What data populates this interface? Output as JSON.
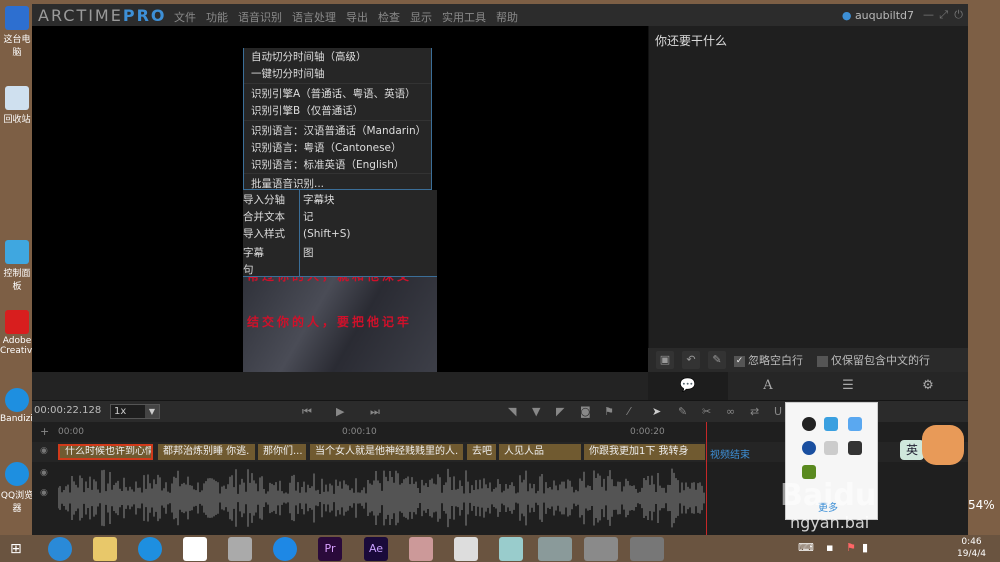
{
  "desktop": {
    "icons": [
      "这台电脑",
      "回收站",
      "控制面板",
      "Adobe Creative",
      "Bandizip",
      "QQ浏览器"
    ]
  },
  "app": {
    "logo_main": "ARCTIME",
    "logo_pro": "PRO",
    "menu": [
      "文件",
      "功能",
      "语音识别",
      "语言处理",
      "导出",
      "检查",
      "显示",
      "实用工具",
      "帮助"
    ],
    "user": "auqubiltd7"
  },
  "dropdown": {
    "items": [
      "自动切分时间轴（高级）",
      "一键切分时间轴",
      "识别引擎A（普通话、粤语、英语）",
      "识别引擎B（仅普通话）",
      "识别语言：汉语普通话（Mandarin）",
      "识别语言：粤语（Cantonese）",
      "识别语言：标准英语（English）",
      "批量语音识别..."
    ]
  },
  "submenu_partial": {
    "left": [
      "导入分轴",
      "合并文本",
      "导入样式",
      "字幕",
      "句"
    ],
    "right": [
      "字幕块",
      "记",
      "(Shift+S)",
      "图"
    ]
  },
  "video": {
    "subtitle_lines": [
      "帮过你的人，就和他深交",
      "结交你的人，要把他记牢"
    ]
  },
  "right_panel": {
    "text": "你还要干什么",
    "ignore_blank": "忽略空白行",
    "keep_chinese": "仅保留包含中文的行",
    "ignore_blank_checked": true,
    "keep_chinese_checked": false
  },
  "controls": {
    "time": "00:00:22.128",
    "speed": "1x"
  },
  "ruler": {
    "ticks": [
      "00:00",
      "0:00:10",
      "0:00:20"
    ]
  },
  "subtitles": [
    "什么时候也许到心情",
    "都邦治炼别睡 你逃.",
    "那你们...",
    "当个女人就是他神经贱贱里的人.",
    "去吧",
    "人见人品",
    "你跟我更加1下 我转身"
  ],
  "video_end": "视频结束",
  "tray": {
    "more": "更多"
  },
  "watermark": {
    "text": "Baidu",
    "sub": "ngyan.bai"
  },
  "mascot": {
    "label": "英",
    "battery": "54%"
  },
  "clock": {
    "time": "0:46",
    "date": "19/4/4"
  },
  "colors": {
    "accent": "#3d8fd6",
    "subtitle_block": "#705a30",
    "playhead": "#c62828"
  }
}
